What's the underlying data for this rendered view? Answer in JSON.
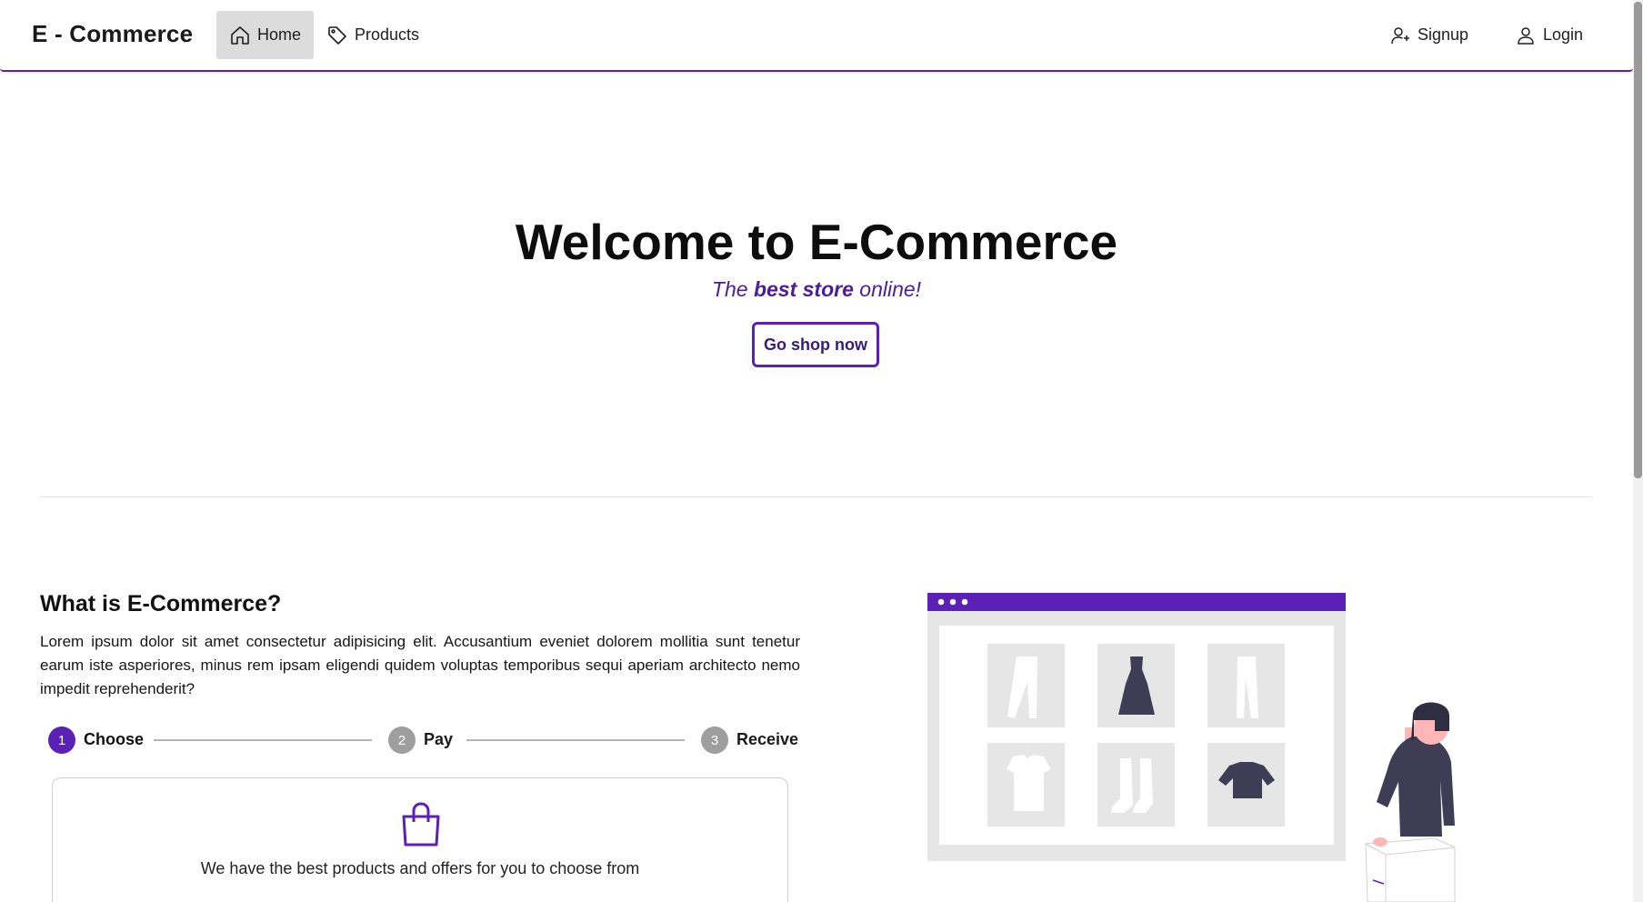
{
  "nav": {
    "brand": "E - Commerce",
    "home": "Home",
    "products": "Products",
    "signup": "Signup",
    "login": "Login"
  },
  "hero": {
    "title": "Welcome to E-Commerce",
    "subtitle_pre": "The ",
    "subtitle_bold": "best store",
    "subtitle_post": " online!",
    "cta": "Go shop now"
  },
  "about": {
    "title": "What is E-Commerce?",
    "text": "Lorem ipsum dolor sit amet consectetur adipisicing elit. Accusantium eveniet dolorem mollitia sunt tenetur earum iste asperiores, minus rem ipsam eligendi quidem voluptas temporibus sequi aperiam architecto nemo impedit reprehenderit?"
  },
  "stepper": {
    "steps": [
      {
        "number": "1",
        "label": "Choose",
        "active": true
      },
      {
        "number": "2",
        "label": "Pay",
        "active": false
      },
      {
        "number": "3",
        "label": "Receive",
        "active": false
      }
    ],
    "card_text": "We have the best products and offers for you to choose from"
  },
  "colors": {
    "accent": "#5b21b6",
    "inactive_step": "#9e9e9e"
  }
}
